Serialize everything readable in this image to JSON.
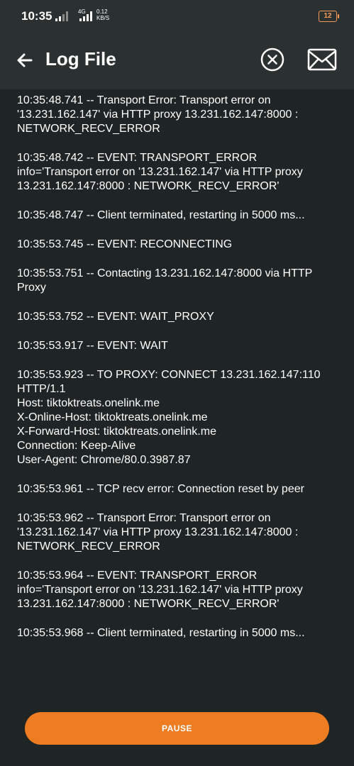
{
  "status_bar": {
    "time": "10:35",
    "network_type": "4G",
    "speed_value": "0.12",
    "speed_unit": "KB/S",
    "battery": "12",
    "battery_color": "#f59b5a"
  },
  "app_bar": {
    "title": "Log File",
    "back_icon": "arrow-left-icon",
    "close_icon": "circle-x-icon",
    "mail_icon": "envelope-icon"
  },
  "log_entries": [
    "10:35:48.741 -- Transport Error: Transport error on\n'13.231.162.147' via HTTP proxy 13.231.162.147:8000 :\nNETWORK_RECV_ERROR",
    "10:35:48.742 -- EVENT: TRANSPORT_ERROR\ninfo='Transport error on '13.231.162.147' via HTTP proxy\n13.231.162.147:8000 : NETWORK_RECV_ERROR'",
    "10:35:48.747 -- Client terminated, restarting in 5000 ms...",
    "10:35:53.745 -- EVENT: RECONNECTING",
    "10:35:53.751 -- Contacting 13.231.162.147:8000 via HTTP\nProxy",
    "10:35:53.752 -- EVENT: WAIT_PROXY",
    "10:35:53.917 -- EVENT: WAIT",
    "10:35:53.923 -- TO PROXY: CONNECT 13.231.162.147:110\nHTTP/1.1\nHost: tiktoktreats.onelink.me\nX-Online-Host: tiktoktreats.onelink.me\nX-Forward-Host: tiktoktreats.onelink.me\nConnection: Keep-Alive\nUser-Agent: Chrome/80.0.3987.87",
    "10:35:53.961 -- TCP recv error: Connection reset by peer",
    "10:35:53.962 -- Transport Error: Transport error on\n'13.231.162.147' via HTTP proxy 13.231.162.147:8000 :\nNETWORK_RECV_ERROR",
    "10:35:53.964 -- EVENT: TRANSPORT_ERROR\ninfo='Transport error on '13.231.162.147' via HTTP proxy\n13.231.162.147:8000 : NETWORK_RECV_ERROR'",
    "10:35:53.968 -- Client terminated, restarting in 5000 ms..."
  ],
  "pause_button": {
    "label": "PAUSE",
    "color": "#ee7d22"
  }
}
